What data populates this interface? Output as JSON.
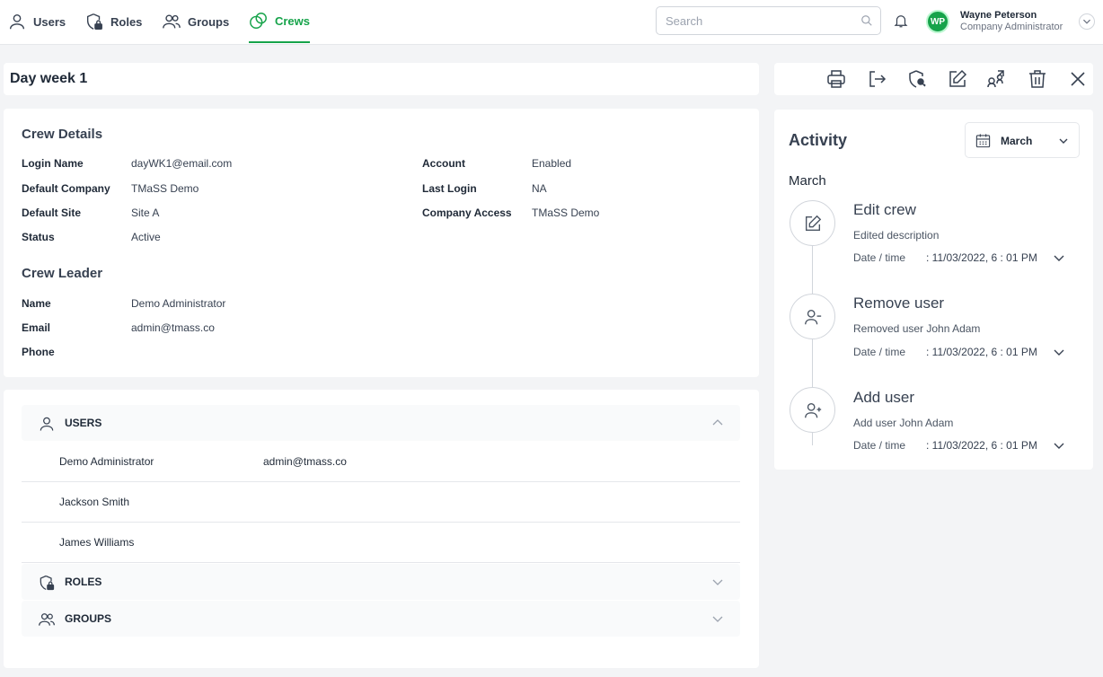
{
  "nav": {
    "tabs": [
      {
        "label": "Users",
        "icon": "user-icon"
      },
      {
        "label": "Roles",
        "icon": "shield-lock-icon"
      },
      {
        "label": "Groups",
        "icon": "group-icon"
      },
      {
        "label": "Crews",
        "icon": "crew-icon",
        "active": true
      }
    ],
    "search_placeholder": "Search",
    "user": {
      "initials": "WP",
      "name": "Wayne Peterson",
      "role": "Company Administrator"
    }
  },
  "page": {
    "title": "Day week 1"
  },
  "toolbar": {
    "actions": [
      "print-icon",
      "export-icon",
      "key-icon",
      "edit-icon",
      "move-icon",
      "trash-icon",
      "close-icon"
    ]
  },
  "crew_details": {
    "heading": "Crew Details",
    "left": [
      {
        "label": "Login Name",
        "value": "dayWK1@email.com"
      },
      {
        "label": "Default Company",
        "value": "TMaSS Demo"
      },
      {
        "label": "Default Site",
        "value": "Site A"
      },
      {
        "label": "Status",
        "value": "Active"
      }
    ],
    "right": [
      {
        "label": "Account",
        "value": "Enabled"
      },
      {
        "label": "Last Login",
        "value": "NA"
      },
      {
        "label": "Company Access",
        "value": "TMaSS Demo"
      }
    ]
  },
  "crew_leader": {
    "heading": "Crew Leader",
    "fields": [
      {
        "label": "Name",
        "value": "Demo Administrator"
      },
      {
        "label": "Email",
        "value": "admin@tmass.co"
      },
      {
        "label": "Phone",
        "value": ""
      }
    ]
  },
  "sections": {
    "users": {
      "label": "USERS",
      "rows": [
        {
          "name": "Demo Administrator",
          "email": "admin@tmass.co"
        },
        {
          "name": "Jackson Smith",
          "email": ""
        },
        {
          "name": "James Williams",
          "email": ""
        }
      ]
    },
    "roles": {
      "label": "ROLES"
    },
    "groups": {
      "label": "GROUPS"
    }
  },
  "activity": {
    "title": "Activity",
    "month_select": "March",
    "month_label": "March",
    "events": [
      {
        "title": "Edit crew",
        "desc": "Edited description",
        "date_label": "Date / time",
        "date_value": ": 11/03/2022, 6 : 01 PM",
        "icon": "edit-icon"
      },
      {
        "title": "Remove user",
        "desc": "Removed user John Adam",
        "date_label": "Date / time",
        "date_value": ": 11/03/2022, 6 : 01 PM",
        "icon": "user-minus-icon"
      },
      {
        "title": "Add user",
        "desc": "Add user John Adam",
        "date_label": "Date / time",
        "date_value": ": 11/03/2022, 6 : 01 PM",
        "icon": "user-plus-icon"
      }
    ]
  },
  "colors": {
    "accent": "#16a34a",
    "text": "#1f2937",
    "muted": "#6b7280",
    "background": "#f3f4f6"
  }
}
